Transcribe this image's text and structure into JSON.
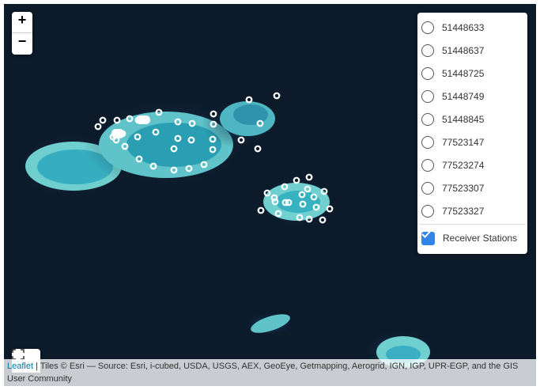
{
  "zoom": {
    "in_label": "+",
    "out_label": "−"
  },
  "layers": {
    "base_layers": [
      "51448633",
      "51448637",
      "51448725",
      "51448749",
      "51448845",
      "77523147",
      "77523274",
      "77523307",
      "77523327"
    ],
    "overlay": {
      "label": "Receiver Stations",
      "checked": true
    }
  },
  "attribution": {
    "link_text": "Leaflet",
    "separator": " | ",
    "text": "Tiles © Esri — Source: Esri, i-cubed, USDA, USGS, AEX, GeoEye, Getmapping, Aerogrid, IGN, IGP, UPR-EGP, and the GIS User Community"
  },
  "colors": {
    "ocean": "#0c1a2a",
    "reef": "#5fc3c9",
    "lagoon": "#2a9fb4",
    "marker": "#ffffff",
    "checkbox": "#2f86e7"
  }
}
